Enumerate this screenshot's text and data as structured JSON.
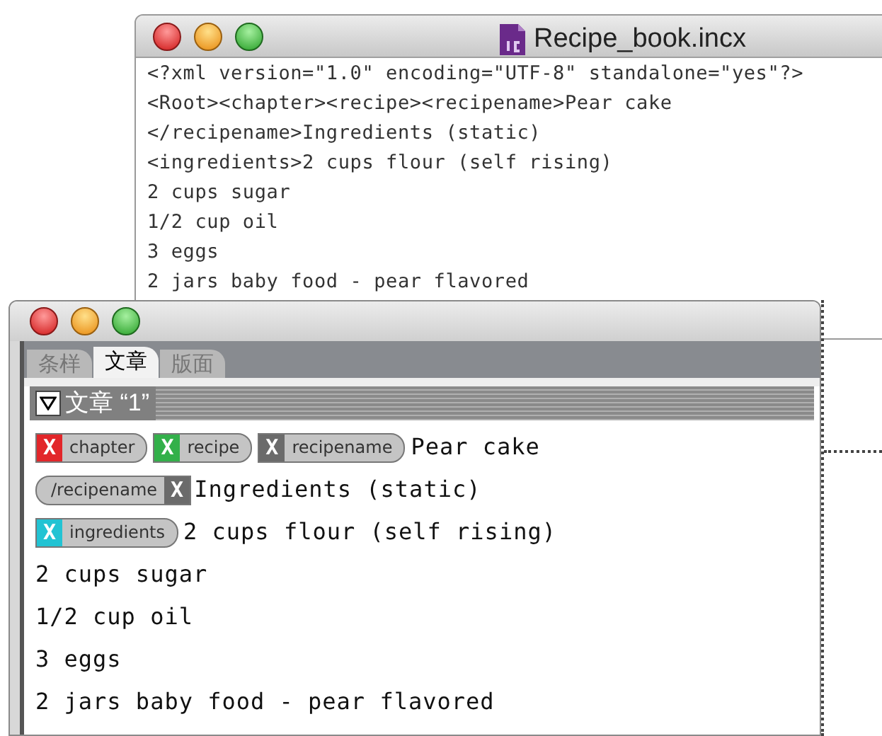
{
  "xml_window": {
    "title": "Recipe_book.incx",
    "lines": [
      "<?xml version=\"1.0\" encoding=\"UTF-8\" standalone=\"yes\"?>",
      "<Root><chapter><recipe><recipename>Pear cake",
      "</recipename>Ingredients (static)",
      "<ingredients>2 cups flour (self rising)",
      "2 cups sugar",
      "1/2 cup oil",
      "3 eggs",
      "2 jars baby food - pear flavored"
    ]
  },
  "story_window": {
    "tabs": [
      {
        "label": "条样",
        "selected": false
      },
      {
        "label": "文章",
        "selected": true
      },
      {
        "label": "版面",
        "selected": false
      }
    ],
    "story": {
      "title": "文章 “1”",
      "expanded": true
    },
    "lines": [
      {
        "segments": [
          {
            "kind": "open_tag",
            "mark": "X",
            "label": "chapter",
            "color": "#e2262a"
          },
          {
            "kind": "open_tag",
            "mark": "X",
            "label": "recipe",
            "color": "#33b04a"
          },
          {
            "kind": "open_tag",
            "mark": "X",
            "label": "recipename",
            "color": "#6b6b6b"
          },
          {
            "kind": "text",
            "text": "Pear cake"
          }
        ]
      },
      {
        "segments": [
          {
            "kind": "close_tag",
            "mark": "X",
            "label": "/recipename",
            "color": "#6b6b6b"
          },
          {
            "kind": "text",
            "text": "Ingredients (static)"
          }
        ]
      },
      {
        "segments": [
          {
            "kind": "open_tag",
            "mark": "X",
            "label": "ingredients",
            "color": "#22c3d3"
          },
          {
            "kind": "text",
            "text": "2 cups flour (self rising)"
          }
        ]
      },
      {
        "segments": [
          {
            "kind": "text",
            "text": "2 cups sugar"
          }
        ]
      },
      {
        "segments": [
          {
            "kind": "text",
            "text": "1/2 cup oil"
          }
        ]
      },
      {
        "segments": [
          {
            "kind": "text",
            "text": "3 eggs"
          }
        ]
      },
      {
        "segments": [
          {
            "kind": "text",
            "text": "2 jars baby food - pear flavored"
          }
        ]
      }
    ]
  }
}
